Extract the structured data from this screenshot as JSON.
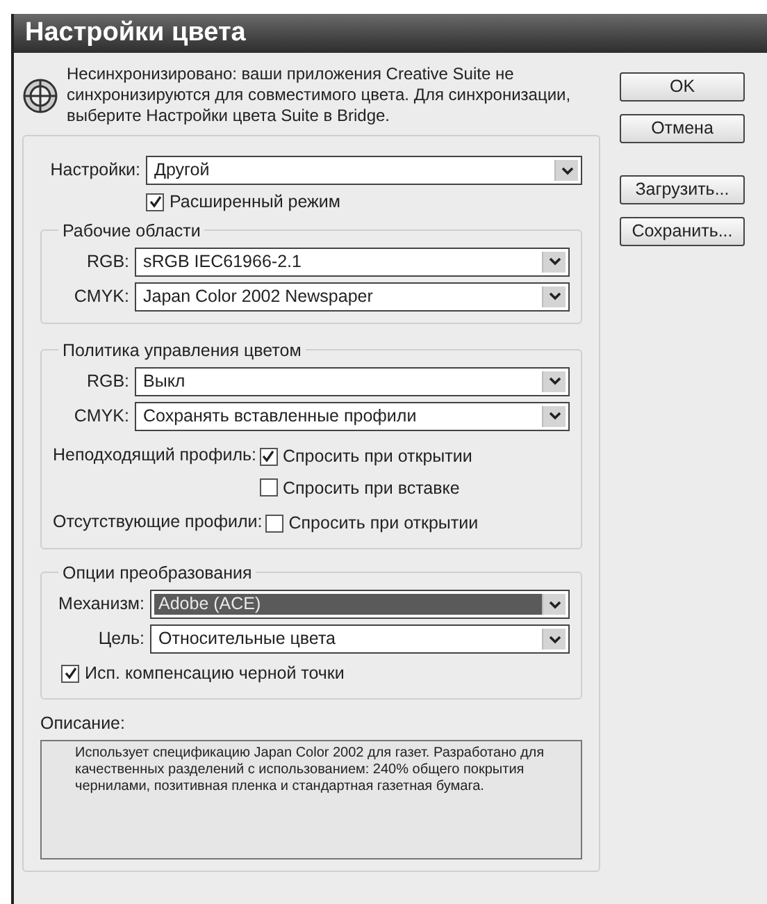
{
  "window": {
    "title": "Настройки цвета"
  },
  "notice": {
    "text": "Несинхронизировано: ваши приложения Creative Suite не синхронизируются для совместимого цвета. Для синхронизации, выберите Настройки цвета Suite в Bridge."
  },
  "buttons": [
    {
      "label": "OK"
    },
    {
      "label": "Отмена"
    },
    {
      "label": "Загрузить..."
    },
    {
      "label": "Сохранить..."
    }
  ],
  "settings": {
    "label": "Настройки:",
    "value": "Другой",
    "highlighted": false
  },
  "advanced_mode": {
    "label": "Расширенный режим",
    "checked": true
  },
  "working_spaces": {
    "title": "Рабочие области",
    "rows": [
      {
        "label": "RGB:",
        "value": "sRGB IEC61966-2.1",
        "highlighted": false
      },
      {
        "label": "CMYK:",
        "value": "Japan Color 2002 Newspaper",
        "highlighted": false
      }
    ]
  },
  "policies": {
    "title": "Политика управления цветом",
    "rows": [
      {
        "label": "RGB:",
        "value": "Выкл",
        "highlighted": false
      },
      {
        "label": "CMYK:",
        "value": "Сохранять вставленные профили",
        "highlighted": false
      }
    ],
    "checks": [
      {
        "label": "Неподходящий профиль:",
        "options": [
          {
            "label": "Спросить при открытии",
            "checked": true
          },
          {
            "label": "Спросить при вставке",
            "checked": false
          }
        ]
      },
      {
        "label": "Отсутствующие профили:",
        "options": [
          {
            "label": "Спросить при открытии",
            "checked": false
          }
        ]
      }
    ]
  },
  "conversion": {
    "title": "Опции преобразования",
    "rows": [
      {
        "label": "Механизм:",
        "value": "Adobe (ACE)",
        "highlighted": true
      },
      {
        "label": "Цель:",
        "value": "Относительные цвета",
        "highlighted": false
      }
    ],
    "black_point": {
      "label": "Исп. компенсацию черной точки",
      "checked": true
    }
  },
  "description": {
    "label": "Описание:",
    "text": "Использует спецификацию Japan Color 2002 для газет. Разработано для качественных разделений с использованием: 240% общего покрытия чернилами, позитивная пленка и стандартная газетная бумага."
  }
}
